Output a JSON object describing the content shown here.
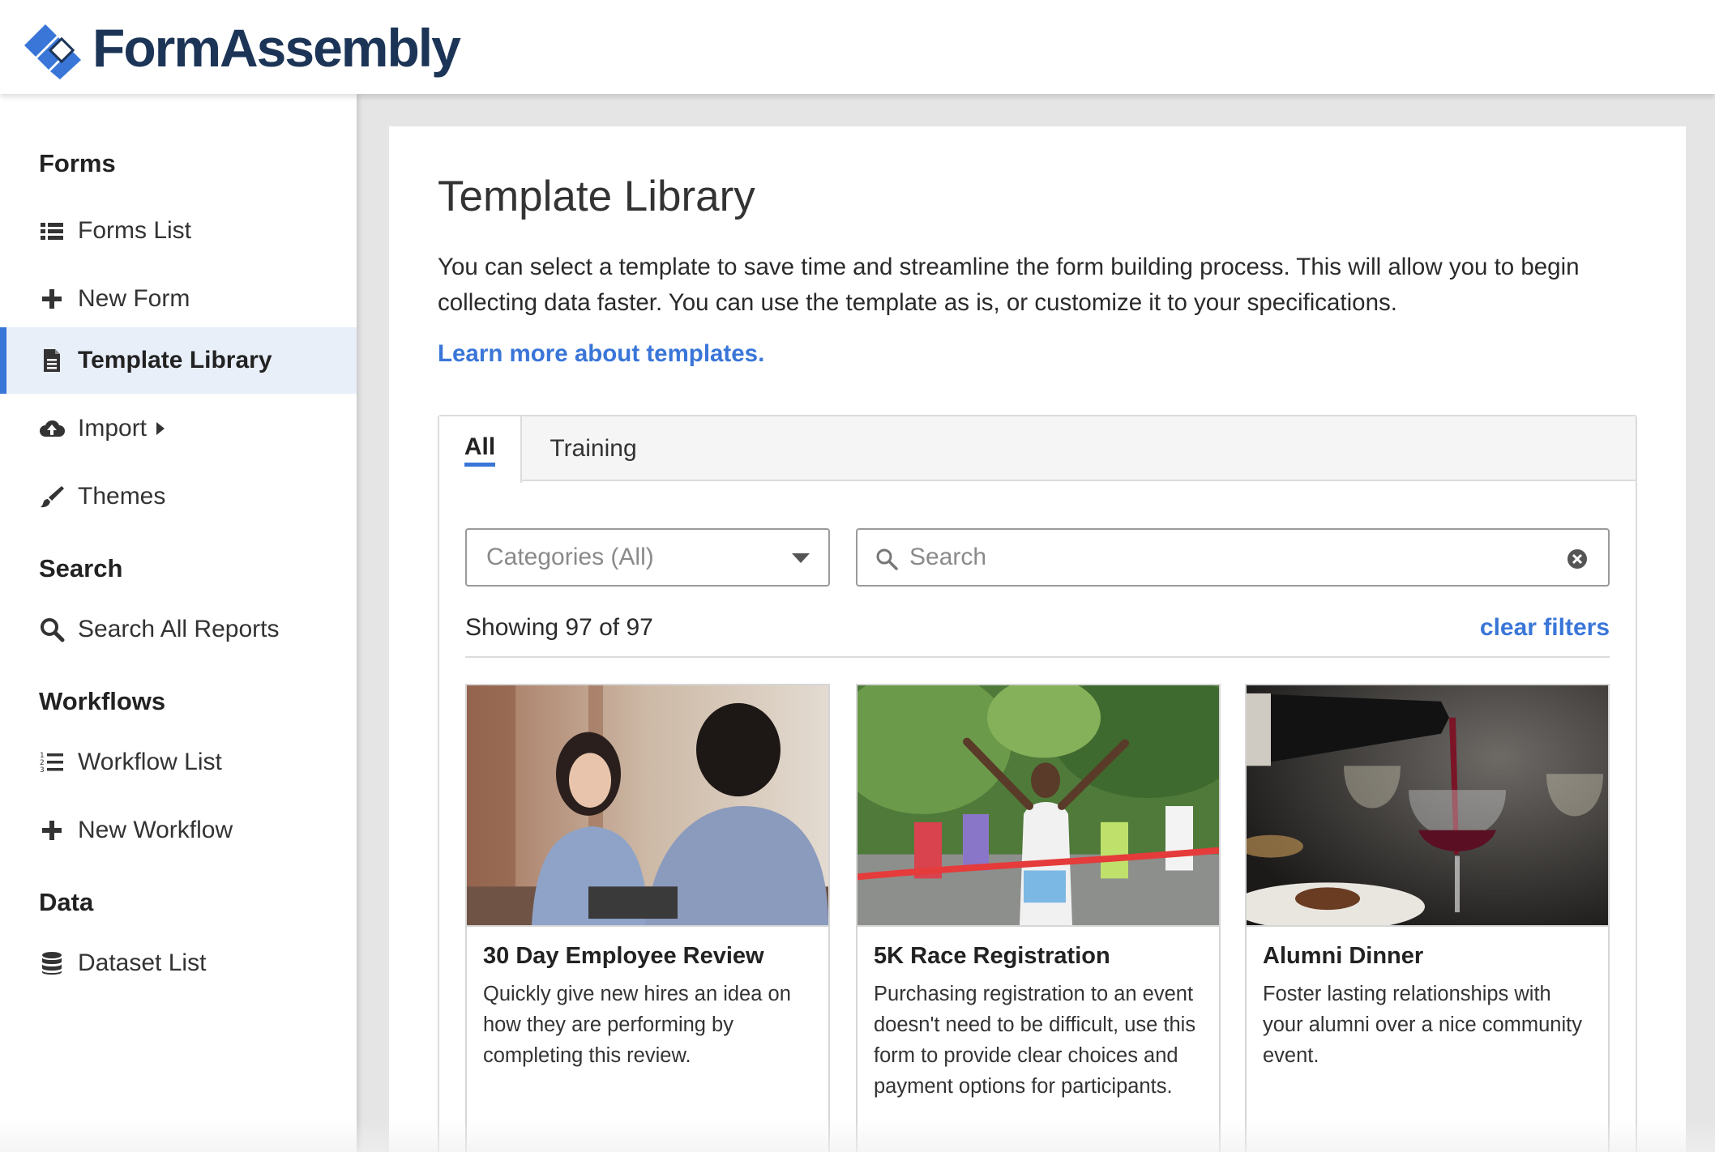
{
  "brand": {
    "name": "FormAssembly",
    "colors": {
      "primary": "#3a76d8",
      "dark": "#1c3557",
      "active_bg": "#e8eff9"
    }
  },
  "sidebar": {
    "sections": [
      {
        "title": "Forms"
      },
      {
        "title": "Search"
      },
      {
        "title": "Workflows"
      },
      {
        "title": "Data"
      }
    ],
    "items": [
      {
        "label": "Forms List",
        "icon": "list-icon"
      },
      {
        "label": "New Form",
        "icon": "plus-icon"
      },
      {
        "label": "Template Library",
        "icon": "file-icon",
        "active": true
      },
      {
        "label": "Import",
        "icon": "cloud-upload-icon"
      },
      {
        "label": "Themes",
        "icon": "paintbrush-icon"
      },
      {
        "label": "Search All Reports",
        "icon": "search-icon"
      },
      {
        "label": "Workflow List",
        "icon": "numbered-list-icon"
      },
      {
        "label": "New Workflow",
        "icon": "plus-icon"
      },
      {
        "label": "Dataset List",
        "icon": "database-icon"
      }
    ]
  },
  "main": {
    "title": "Template Library",
    "description": "You can select a template to save time and streamline the form building process. This will allow you to begin collecting data faster. You can use the template as is, or customize it to your specifications.",
    "learn_more": "Learn more about templates.",
    "tabs": [
      {
        "label": "All",
        "active": true
      },
      {
        "label": "Training"
      }
    ],
    "filters": {
      "category_value": "Categories (All)",
      "search_placeholder": "Search"
    },
    "showing": "Showing 97 of 97",
    "clear_filters": "clear filters",
    "cards": [
      {
        "title": "30 Day Employee Review",
        "description": "Quickly give new hires an idea on how they are performing by completing this review."
      },
      {
        "title": "5K Race Registration",
        "description": "Purchasing registration to an event doesn't need to be difficult, use this form to provide clear choices and payment options for participants."
      },
      {
        "title": "Alumni Dinner",
        "description": "Foster lasting relationships with your alumni over a nice community event."
      }
    ]
  }
}
